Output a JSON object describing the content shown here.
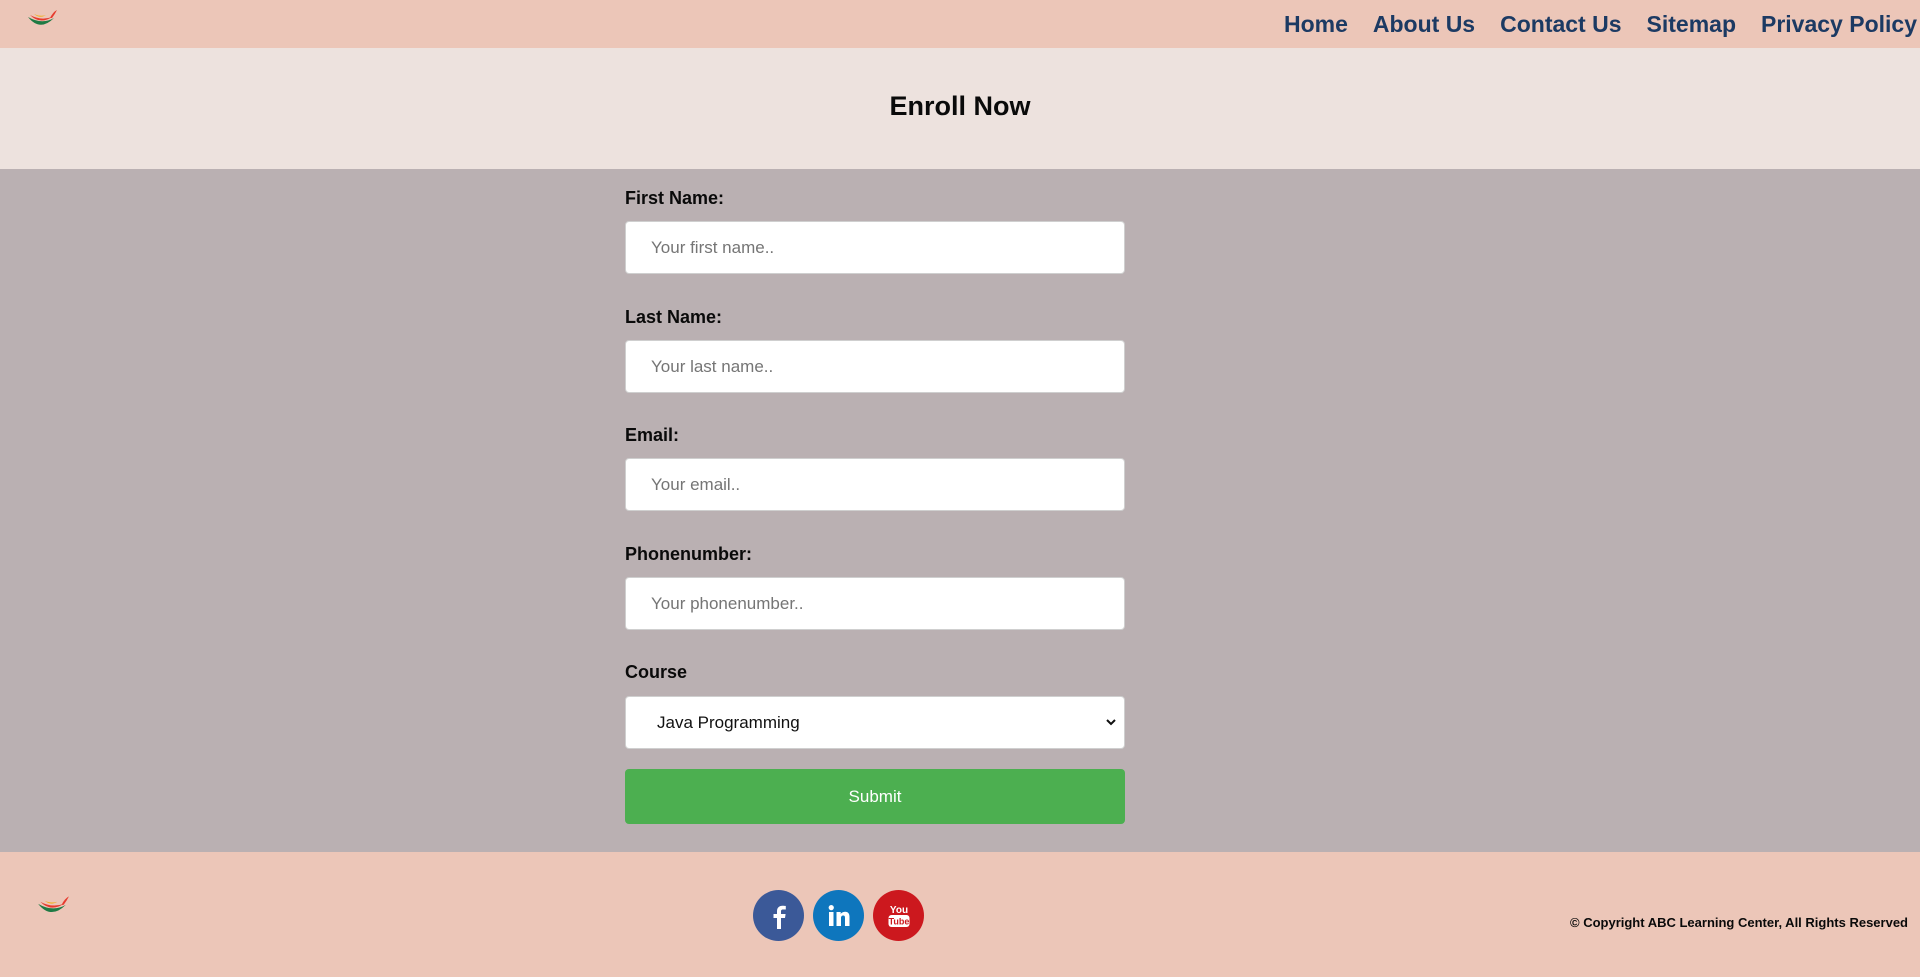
{
  "header": {
    "logo": "brand-logo",
    "nav": [
      "Home",
      "About Us",
      "Contact Us",
      "Sitemap",
      "Privacy Policy"
    ]
  },
  "hero": {
    "title": "Enroll Now"
  },
  "form": {
    "first_name": {
      "label": "First Name:",
      "placeholder": "Your first name.."
    },
    "last_name": {
      "label": "Last Name:",
      "placeholder": "Your last name.."
    },
    "email": {
      "label": "Email:",
      "placeholder": "Your email.."
    },
    "phone": {
      "label": "Phonenumber:",
      "placeholder": "Your phonenumber.."
    },
    "course": {
      "label": "Course",
      "selected": "Java Programming"
    },
    "submit_label": "Submit"
  },
  "footer": {
    "social": [
      {
        "name": "facebook-icon",
        "glyph": "f",
        "color": "#3b5998"
      },
      {
        "name": "linkedin-icon",
        "glyph": "in",
        "color": "#0e76bd"
      },
      {
        "name": "youtube-icon",
        "glyph": "You Tube",
        "color": "#cc181e"
      }
    ],
    "copyright": "© Copyright ABC Learning Center, All Rights Reserved"
  },
  "colors": {
    "header_bg": "#ecc6b8",
    "hero_bg": "#ede2de",
    "body_bg": "#bab0b2",
    "nav_text": "#1c3a63",
    "submit_bg": "#4caf50"
  }
}
